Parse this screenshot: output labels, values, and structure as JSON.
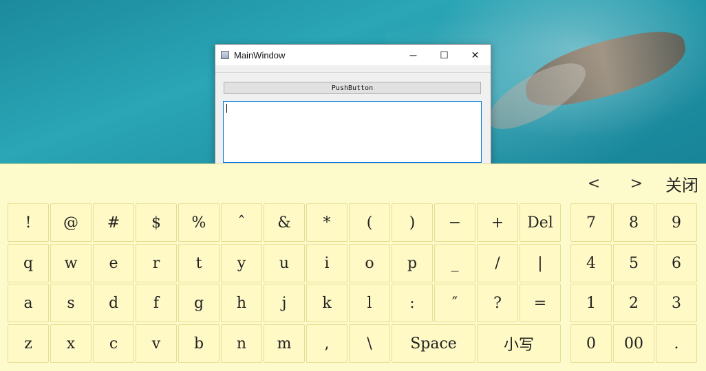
{
  "window": {
    "title": "MainWindow",
    "minimize": "─",
    "maximize": "☐",
    "close": "✕",
    "push_button": "PushButton",
    "text_value": ""
  },
  "keyboard": {
    "prev": "<",
    "next": ">",
    "close": "关闭",
    "main_rows": [
      [
        "!",
        "@",
        "#",
        "$",
        "%",
        "ˆ",
        "&",
        "*",
        "(",
        ")",
        "−",
        "+",
        "Del"
      ],
      [
        "q",
        "w",
        "e",
        "r",
        "t",
        "y",
        "u",
        "i",
        "o",
        "p",
        "_",
        "/",
        "|"
      ],
      [
        "a",
        "s",
        "d",
        "f",
        "g",
        "h",
        "j",
        "k",
        "l",
        ":",
        "″",
        "?",
        "="
      ],
      [
        "z",
        "x",
        "c",
        "v",
        "b",
        "n",
        "m",
        ",",
        "\\",
        "Space",
        "小写"
      ]
    ],
    "num_rows": [
      [
        "7",
        "8",
        "9"
      ],
      [
        "4",
        "5",
        "6"
      ],
      [
        "1",
        "2",
        "3"
      ],
      [
        "0",
        "00",
        "."
      ]
    ]
  }
}
